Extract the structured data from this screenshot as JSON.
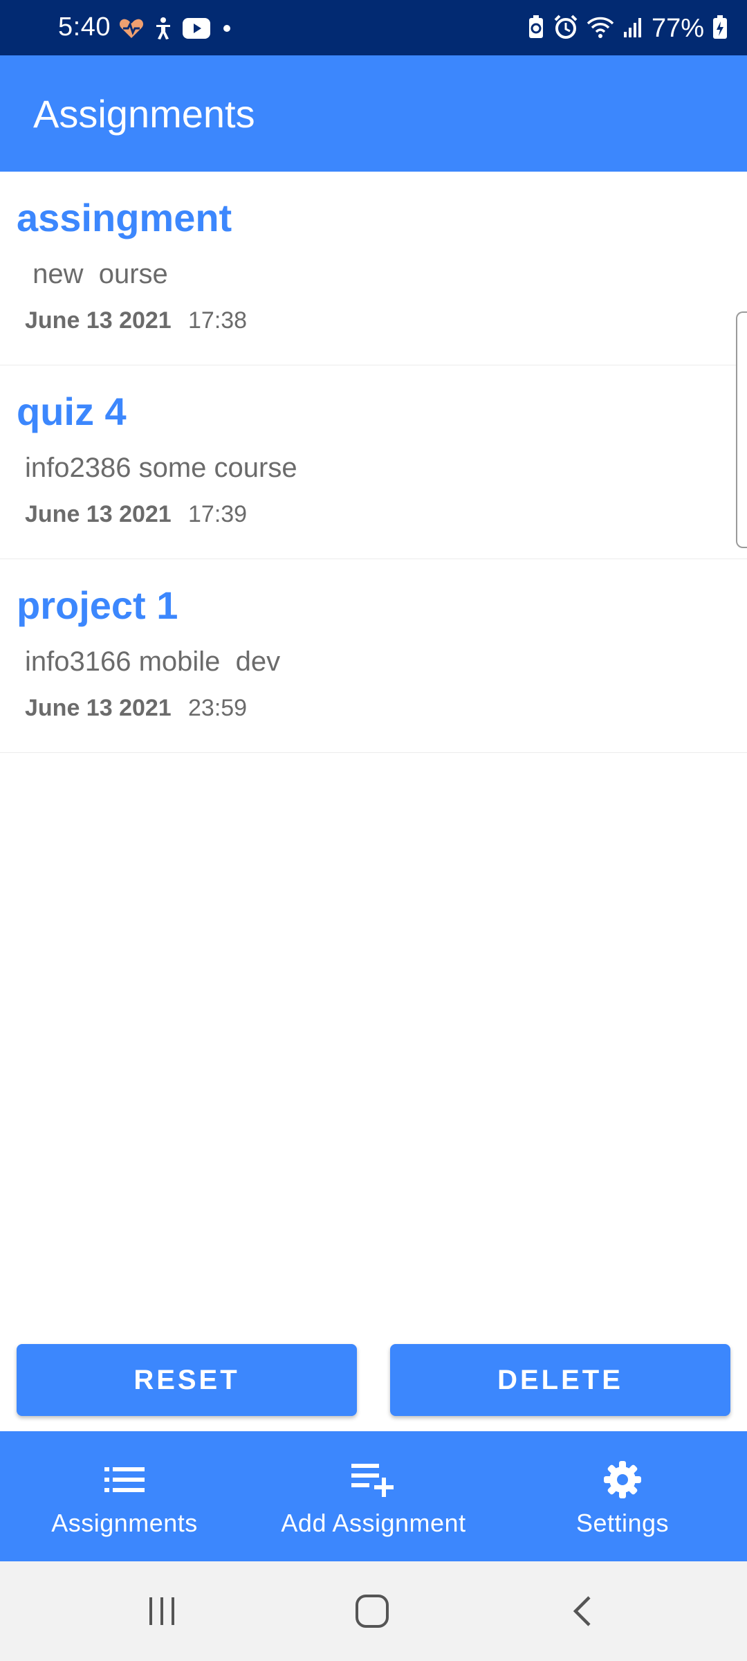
{
  "status_bar": {
    "time": "5:40",
    "battery": "77%",
    "left_icons": [
      "heart-rate-icon",
      "accessibility-icon",
      "youtube-icon",
      "dot-icon"
    ],
    "right_icons": [
      "battery-saver-icon",
      "alarm-icon",
      "wifi-icon",
      "signal-icon",
      "battery-charging-icon"
    ]
  },
  "app_bar": {
    "title": "Assignments"
  },
  "assignments": [
    {
      "title": "assingment",
      "course": " new  ourse",
      "date": "June 13 2021",
      "time": "17:38"
    },
    {
      "title": "quiz 4",
      "course": "info2386 some course",
      "date": "June 13 2021",
      "time": "17:39"
    },
    {
      "title": "project 1",
      "course": "info3166 mobile  dev",
      "date": "June 13 2021",
      "time": "23:59"
    }
  ],
  "actions": {
    "reset_label": "RESET",
    "delete_label": "DELETE"
  },
  "bottom_nav": {
    "items": [
      {
        "label": "Assignments",
        "icon": "list-icon"
      },
      {
        "label": "Add Assignment",
        "icon": "playlist-add-icon"
      },
      {
        "label": "Settings",
        "icon": "gear-icon"
      }
    ]
  },
  "colors": {
    "primary": "#3c87fd",
    "status_bar": "#022a72",
    "secondary_text": "#6b6b6b",
    "system_nav": "#f2f2f2"
  }
}
